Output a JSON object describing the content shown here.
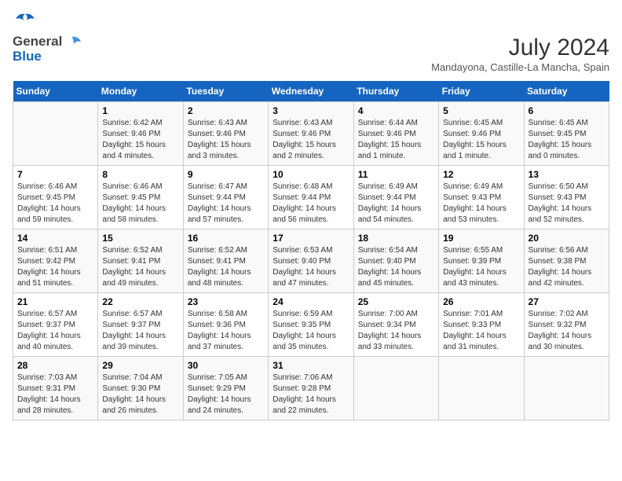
{
  "header": {
    "logo": {
      "general": "General",
      "blue": "Blue"
    },
    "title": "July 2024",
    "subtitle": "Mandayona, Castille-La Mancha, Spain"
  },
  "calendar": {
    "weekdays": [
      "Sunday",
      "Monday",
      "Tuesday",
      "Wednesday",
      "Thursday",
      "Friday",
      "Saturday"
    ],
    "weeks": [
      [
        {
          "day": "",
          "info": ""
        },
        {
          "day": "1",
          "info": "Sunrise: 6:42 AM\nSunset: 9:46 PM\nDaylight: 15 hours\nand 4 minutes."
        },
        {
          "day": "2",
          "info": "Sunrise: 6:43 AM\nSunset: 9:46 PM\nDaylight: 15 hours\nand 3 minutes."
        },
        {
          "day": "3",
          "info": "Sunrise: 6:43 AM\nSunset: 9:46 PM\nDaylight: 15 hours\nand 2 minutes."
        },
        {
          "day": "4",
          "info": "Sunrise: 6:44 AM\nSunset: 9:46 PM\nDaylight: 15 hours\nand 1 minute."
        },
        {
          "day": "5",
          "info": "Sunrise: 6:45 AM\nSunset: 9:46 PM\nDaylight: 15 hours\nand 1 minute."
        },
        {
          "day": "6",
          "info": "Sunrise: 6:45 AM\nSunset: 9:45 PM\nDaylight: 15 hours\nand 0 minutes."
        }
      ],
      [
        {
          "day": "7",
          "info": "Sunrise: 6:46 AM\nSunset: 9:45 PM\nDaylight: 14 hours\nand 59 minutes."
        },
        {
          "day": "8",
          "info": "Sunrise: 6:46 AM\nSunset: 9:45 PM\nDaylight: 14 hours\nand 58 minutes."
        },
        {
          "day": "9",
          "info": "Sunrise: 6:47 AM\nSunset: 9:44 PM\nDaylight: 14 hours\nand 57 minutes."
        },
        {
          "day": "10",
          "info": "Sunrise: 6:48 AM\nSunset: 9:44 PM\nDaylight: 14 hours\nand 56 minutes."
        },
        {
          "day": "11",
          "info": "Sunrise: 6:49 AM\nSunset: 9:44 PM\nDaylight: 14 hours\nand 54 minutes."
        },
        {
          "day": "12",
          "info": "Sunrise: 6:49 AM\nSunset: 9:43 PM\nDaylight: 14 hours\nand 53 minutes."
        },
        {
          "day": "13",
          "info": "Sunrise: 6:50 AM\nSunset: 9:43 PM\nDaylight: 14 hours\nand 52 minutes."
        }
      ],
      [
        {
          "day": "14",
          "info": "Sunrise: 6:51 AM\nSunset: 9:42 PM\nDaylight: 14 hours\nand 51 minutes."
        },
        {
          "day": "15",
          "info": "Sunrise: 6:52 AM\nSunset: 9:41 PM\nDaylight: 14 hours\nand 49 minutes."
        },
        {
          "day": "16",
          "info": "Sunrise: 6:52 AM\nSunset: 9:41 PM\nDaylight: 14 hours\nand 48 minutes."
        },
        {
          "day": "17",
          "info": "Sunrise: 6:53 AM\nSunset: 9:40 PM\nDaylight: 14 hours\nand 47 minutes."
        },
        {
          "day": "18",
          "info": "Sunrise: 6:54 AM\nSunset: 9:40 PM\nDaylight: 14 hours\nand 45 minutes."
        },
        {
          "day": "19",
          "info": "Sunrise: 6:55 AM\nSunset: 9:39 PM\nDaylight: 14 hours\nand 43 minutes."
        },
        {
          "day": "20",
          "info": "Sunrise: 6:56 AM\nSunset: 9:38 PM\nDaylight: 14 hours\nand 42 minutes."
        }
      ],
      [
        {
          "day": "21",
          "info": "Sunrise: 6:57 AM\nSunset: 9:37 PM\nDaylight: 14 hours\nand 40 minutes."
        },
        {
          "day": "22",
          "info": "Sunrise: 6:57 AM\nSunset: 9:37 PM\nDaylight: 14 hours\nand 39 minutes."
        },
        {
          "day": "23",
          "info": "Sunrise: 6:58 AM\nSunset: 9:36 PM\nDaylight: 14 hours\nand 37 minutes."
        },
        {
          "day": "24",
          "info": "Sunrise: 6:59 AM\nSunset: 9:35 PM\nDaylight: 14 hours\nand 35 minutes."
        },
        {
          "day": "25",
          "info": "Sunrise: 7:00 AM\nSunset: 9:34 PM\nDaylight: 14 hours\nand 33 minutes."
        },
        {
          "day": "26",
          "info": "Sunrise: 7:01 AM\nSunset: 9:33 PM\nDaylight: 14 hours\nand 31 minutes."
        },
        {
          "day": "27",
          "info": "Sunrise: 7:02 AM\nSunset: 9:32 PM\nDaylight: 14 hours\nand 30 minutes."
        }
      ],
      [
        {
          "day": "28",
          "info": "Sunrise: 7:03 AM\nSunset: 9:31 PM\nDaylight: 14 hours\nand 28 minutes."
        },
        {
          "day": "29",
          "info": "Sunrise: 7:04 AM\nSunset: 9:30 PM\nDaylight: 14 hours\nand 26 minutes."
        },
        {
          "day": "30",
          "info": "Sunrise: 7:05 AM\nSunset: 9:29 PM\nDaylight: 14 hours\nand 24 minutes."
        },
        {
          "day": "31",
          "info": "Sunrise: 7:06 AM\nSunset: 9:28 PM\nDaylight: 14 hours\nand 22 minutes."
        },
        {
          "day": "",
          "info": ""
        },
        {
          "day": "",
          "info": ""
        },
        {
          "day": "",
          "info": ""
        }
      ]
    ]
  }
}
